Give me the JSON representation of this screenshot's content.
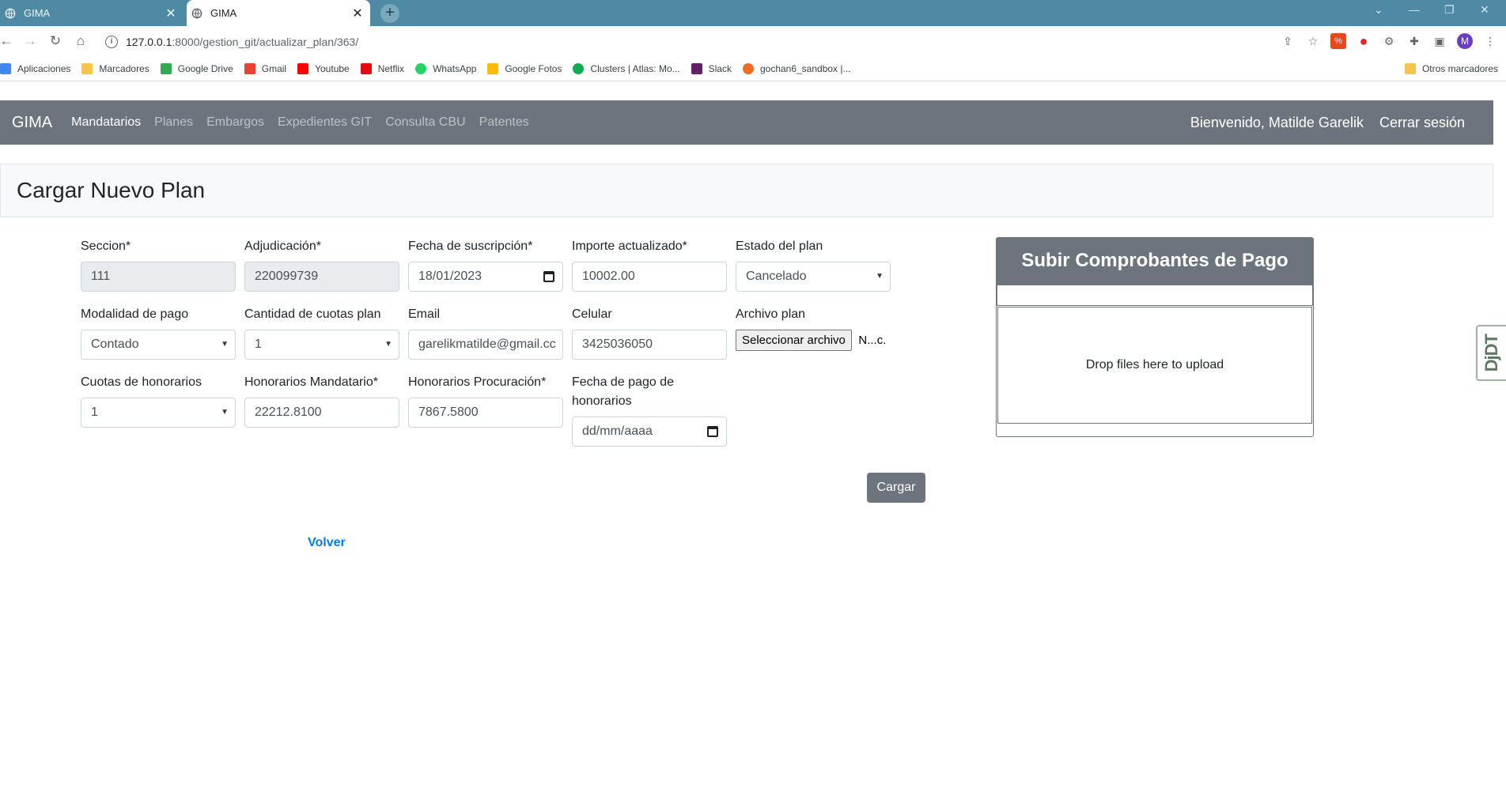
{
  "browser": {
    "tabs": [
      {
        "title": "GIMA",
        "active": false
      },
      {
        "title": "GIMA",
        "active": true
      }
    ],
    "url_host": "127.0.0.1",
    "url_path": ":8000/gestion_git/actualizar_plan/363/",
    "bookmarks": [
      {
        "label": "Aplicaciones",
        "color": "#4285f4"
      },
      {
        "label": "Marcadores",
        "color": "#f4c64d"
      },
      {
        "label": "Google Drive",
        "color": "#34a853"
      },
      {
        "label": "Gmail",
        "color": "#ea4335"
      },
      {
        "label": "Youtube",
        "color": "#ff0000"
      },
      {
        "label": "Netflix",
        "color": "#e50914"
      },
      {
        "label": "WhatsApp",
        "color": "#25d366"
      },
      {
        "label": "Google Fotos",
        "color": "#fbbc05"
      },
      {
        "label": "Clusters | Atlas: Mo...",
        "color": "#13aa52"
      },
      {
        "label": "Slack",
        "color": "#611f69"
      },
      {
        "label": "gochan6_sandbox |...",
        "color": "#f26b21"
      }
    ],
    "other_bookmarks": "Otros marcadores",
    "profile_initial": "M"
  },
  "navbar": {
    "brand": "GIMA",
    "links": [
      "Mandatarios",
      "Planes",
      "Embargos",
      "Expedientes GIT",
      "Consulta CBU",
      "Patentes"
    ],
    "active_link": "Mandatarios",
    "welcome": "Bienvenido, Matilde Garelik",
    "logout": "Cerrar sesión"
  },
  "page": {
    "title": "Cargar Nuevo Plan"
  },
  "form": {
    "seccion": {
      "label": "Seccion*",
      "value": "111"
    },
    "adjudicacion": {
      "label": "Adjudicación*",
      "value": "220099739"
    },
    "fecha_suscripcion": {
      "label": "Fecha de suscripción*",
      "value": "18/01/2023"
    },
    "importe": {
      "label": "Importe actualizado*",
      "value": "10002.00"
    },
    "estado": {
      "label": "Estado del plan",
      "value": "Cancelado"
    },
    "modalidad": {
      "label": "Modalidad de pago",
      "value": "Contado"
    },
    "cuotas_plan": {
      "label": "Cantidad de cuotas plan",
      "value": "1"
    },
    "email": {
      "label": "Email",
      "value": "garelikmatilde@gmail.cc"
    },
    "celular": {
      "label": "Celular",
      "value": "3425036050"
    },
    "archivo": {
      "label": "Archivo plan",
      "button": "Seleccionar archivo",
      "filename": "N...c."
    },
    "cuotas_honorarios": {
      "label": "Cuotas de honorarios",
      "value": "1"
    },
    "hon_mandatario": {
      "label": "Honorarios Mandatario*",
      "value": "22212.8100"
    },
    "hon_procuracion": {
      "label": "Honorarios Procuración*",
      "value": "7867.5800"
    },
    "fecha_pago": {
      "label": "Fecha de pago de honorarios",
      "value": "dd/mm/aaaa"
    },
    "submit": "Cargar",
    "back": "Volver"
  },
  "upload": {
    "title": "Subir Comprobantes de Pago",
    "dropzone": "Drop files here to upload"
  },
  "debug_toolbar": "DjDT"
}
